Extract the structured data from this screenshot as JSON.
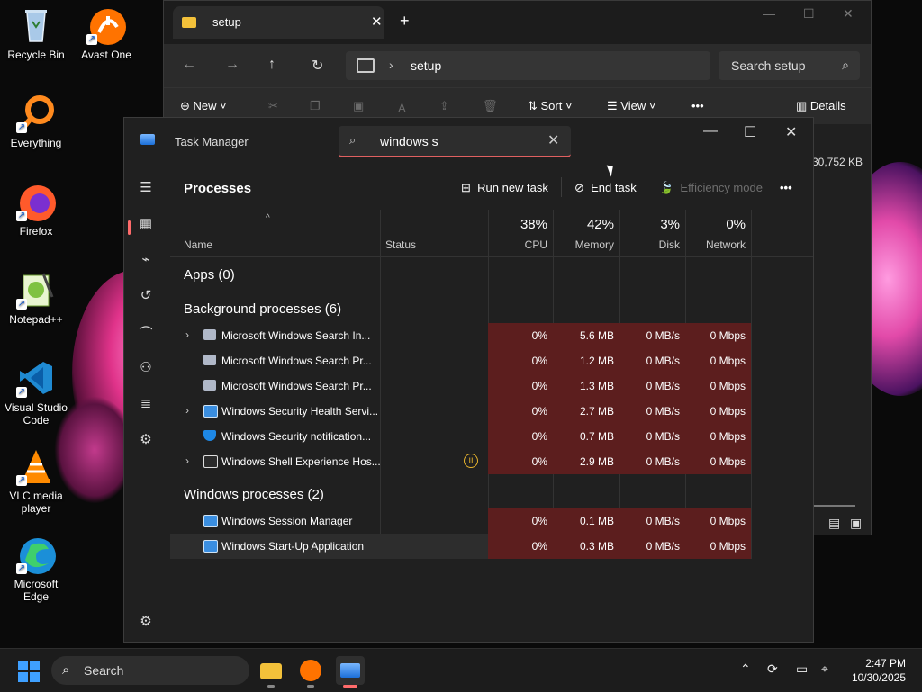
{
  "desktop": {
    "icons": [
      {
        "label": "Recycle Bin",
        "icon": "recycle-bin-icon"
      },
      {
        "label": "Avast One",
        "icon": "avast-icon"
      },
      {
        "label": "Everything",
        "icon": "everything-search-icon"
      },
      {
        "label": "Firefox",
        "icon": "firefox-icon"
      },
      {
        "label": "Notepad++",
        "icon": "notepad-plus-plus-icon"
      },
      {
        "label": "Visual Studio Code",
        "icon": "vscode-icon"
      },
      {
        "label": "VLC media player",
        "icon": "vlc-icon"
      },
      {
        "label": "Microsoft Edge",
        "icon": "edge-icon"
      }
    ]
  },
  "explorer": {
    "tab_title": "setup",
    "address": "setup",
    "search_placeholder": "Search setup",
    "cmd": {
      "new": "New",
      "sort": "Sort",
      "view": "View",
      "more": "•••",
      "details": "Details"
    },
    "visible_size": "30,752 KB"
  },
  "taskmgr": {
    "title": "Task Manager",
    "search_value": "windows s",
    "section": "Processes",
    "toolbar": {
      "run_new_task": "Run new task",
      "end_task": "End task",
      "efficiency_mode": "Efficiency mode",
      "more": "•••"
    },
    "columns": {
      "name": "Name",
      "status": "Status",
      "cpu_pct": "38%",
      "cpu": "CPU",
      "mem_pct": "42%",
      "mem": "Memory",
      "disk_pct": "3%",
      "disk": "Disk",
      "net_pct": "0%",
      "net": "Network"
    },
    "groups": {
      "apps": "Apps (0)",
      "background": "Background processes (6)",
      "windows": "Windows processes (2)"
    },
    "background": [
      {
        "name": "Microsoft Windows Search In...",
        "cpu": "0%",
        "mem": "5.6 MB",
        "disk": "0 MB/s",
        "net": "0 Mbps"
      },
      {
        "name": "Microsoft Windows Search Pr...",
        "cpu": "0%",
        "mem": "1.2 MB",
        "disk": "0 MB/s",
        "net": "0 Mbps"
      },
      {
        "name": "Microsoft Windows Search Pr...",
        "cpu": "0%",
        "mem": "1.3 MB",
        "disk": "0 MB/s",
        "net": "0 Mbps"
      },
      {
        "name": "Windows Security Health Servi...",
        "cpu": "0%",
        "mem": "2.7 MB",
        "disk": "0 MB/s",
        "net": "0 Mbps"
      },
      {
        "name": "Windows Security notification...",
        "cpu": "0%",
        "mem": "0.7 MB",
        "disk": "0 MB/s",
        "net": "0 Mbps"
      },
      {
        "name": "Windows Shell Experience Hos...",
        "cpu": "0%",
        "mem": "2.9 MB",
        "disk": "0 MB/s",
        "net": "0 Mbps"
      }
    ],
    "windows": [
      {
        "name": "Windows Session Manager",
        "cpu": "0%",
        "mem": "0.1 MB",
        "disk": "0 MB/s",
        "net": "0 Mbps"
      },
      {
        "name": "Windows Start-Up Application",
        "cpu": "0%",
        "mem": "0.3 MB",
        "disk": "0 MB/s",
        "net": "0 Mbps"
      }
    ]
  },
  "taskbar": {
    "search_label": "Search",
    "time": "2:47 PM",
    "date": "10/30/2025"
  }
}
